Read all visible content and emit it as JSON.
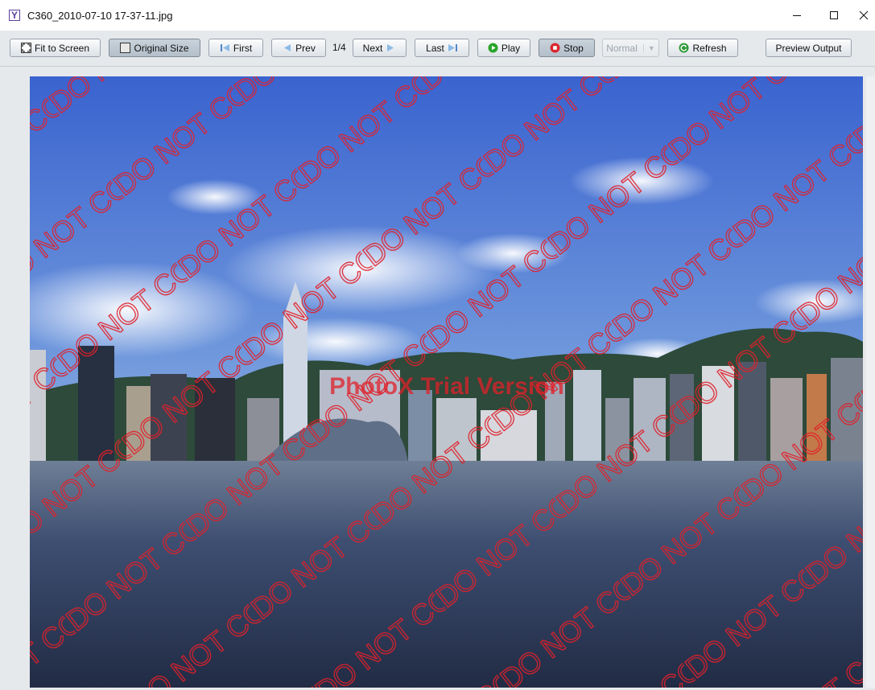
{
  "window": {
    "title": "C360_2010-07-10 17-37-11.jpg",
    "app_icon_glyph": "Y",
    "controls": [
      "minimize-icon",
      "maximize-icon",
      "close-icon"
    ]
  },
  "toolbar": {
    "fit_to_screen": "Fit to Screen",
    "original_size": "Original Size",
    "first": "First",
    "prev": "Prev",
    "page_indicator": "1/4",
    "next": "Next",
    "last": "Last",
    "play": "Play",
    "stop": "Stop",
    "speed_select": "Normal",
    "refresh": "Refresh",
    "preview_output": "Preview Output"
  },
  "photo": {
    "subject": "Victoria Harbour skyline",
    "trial_banner": "PhotoX Trial Version",
    "watermark_text": "DO NOT COPY",
    "watermark_color": "#e0202a"
  },
  "colors": {
    "toolbar_bg": "#e6e9ec",
    "play_green": "#2aa52a",
    "stop_red": "#d9272e",
    "refresh_green": "#2f9a3a",
    "nav_blue": "#6aa3d8"
  }
}
